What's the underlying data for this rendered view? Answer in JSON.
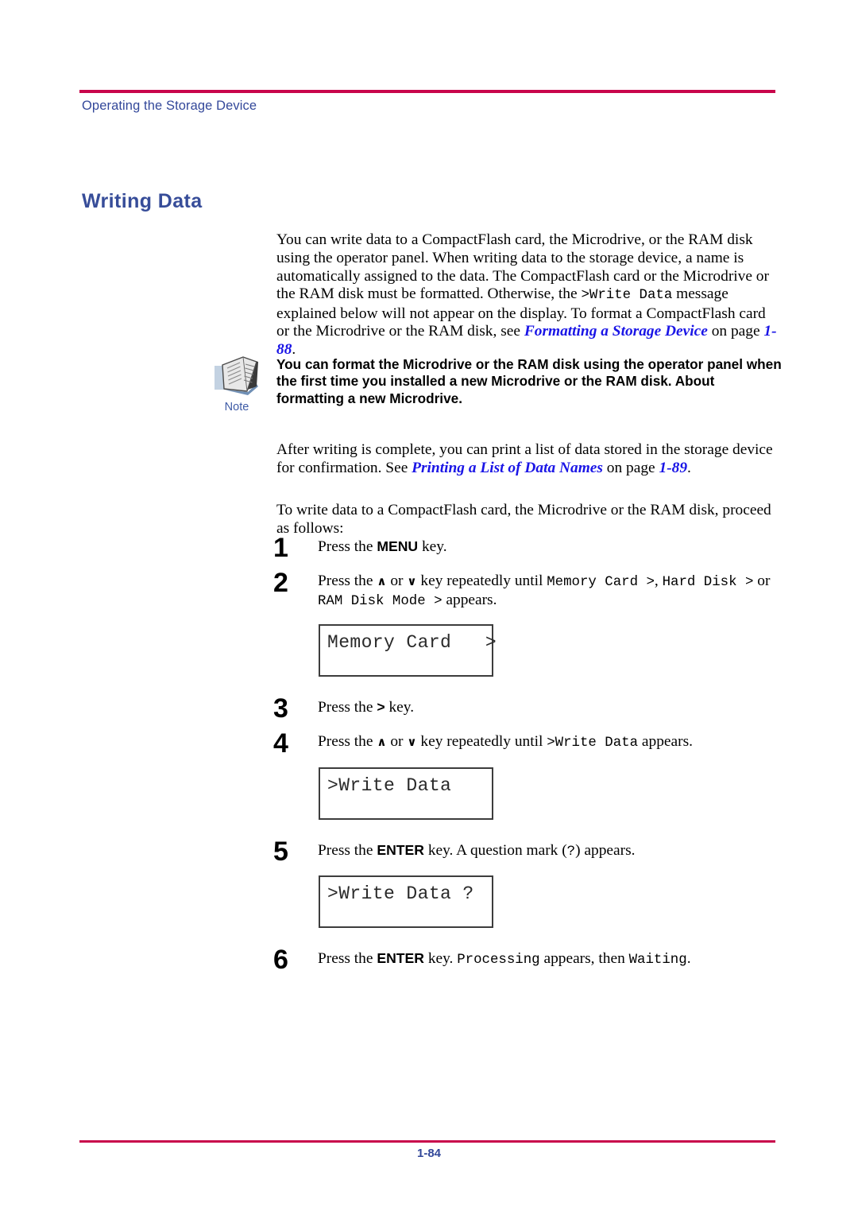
{
  "page": {
    "running_head": "Operating the Storage Device",
    "section_heading": "Writing Data",
    "footer_page_number": "1-84",
    "rule_color": "#C8064B",
    "heading_color": "#374D99",
    "xref_color": "#1A15E6"
  },
  "paragraphs": {
    "intro": {
      "part1": "You can write data to a CompactFlash card, the Microdrive, or the RAM disk using the operator panel. When writing data to the storage device, a name is automatically assigned to the data. The CompactFlash card or the Microdrive or the RAM disk must be formatted. Otherwise, the ",
      "mono1": ">Write Data",
      "part2": " message explained below will not appear on the display. To format a CompactFlash card or the Microdrive or the RAM disk, see ",
      "xref1": "Formatting a Storage Device",
      "part3": " on page ",
      "xref1_page": "1-88",
      "part4": "."
    },
    "after_writing": {
      "part1": "After writing is complete, you can print a list of data stored in the storage device for confirmation. See ",
      "xref1": "Printing a List of Data Names",
      "part2": " on page ",
      "xref1_page": "1-89",
      "part3": "."
    },
    "to_write": "To write data to a CompactFlash card, the Microdrive or the RAM disk, proceed as follows:"
  },
  "note": {
    "caption": "Note",
    "icon": "note-document-icon",
    "text": "You can format the Microdrive or the RAM disk using the operator panel when the first time you installed a new Microdrive or the RAM disk. About formatting a new Microdrive."
  },
  "steps": [
    {
      "number": "1",
      "pre": "Press the ",
      "key": "MENU",
      "post": " key."
    },
    {
      "number": "2",
      "pre": "Press the ",
      "key_up": "∧",
      "mid": " or ",
      "key_down": "∨",
      "post1": " key repeatedly until ",
      "mono1": "Memory Card >",
      "post2": ", ",
      "mono2": "Hard Disk >",
      "post3": " or ",
      "mono3": "RAM Disk Mode >",
      "post4": " appears."
    },
    {
      "number": "3",
      "pre": "Press the ",
      "key": ">",
      "post": " key."
    },
    {
      "number": "4",
      "pre": "Press the ",
      "key_up": "∧",
      "mid": " or ",
      "key_down": "∨",
      "post1": " key repeatedly until ",
      "mono1": ">Write Data",
      "post2": " appears."
    },
    {
      "number": "5",
      "pre": "Press the ",
      "key": "ENTER",
      "post1": " key. A question mark (",
      "mono1": "?",
      "post2": ") appears."
    },
    {
      "number": "6",
      "pre": "Press the ",
      "key": "ENTER",
      "post1": " key. ",
      "mono1": "Processing",
      "post2": " appears, then ",
      "mono2": "Waiting",
      "post3": "."
    }
  ],
  "lcd_panels": [
    {
      "id": "memory-card",
      "line": "Memory Card   >"
    },
    {
      "id": "write-data",
      "line": ">Write Data"
    },
    {
      "id": "write-data-question",
      "line": ">Write Data ?"
    }
  ]
}
